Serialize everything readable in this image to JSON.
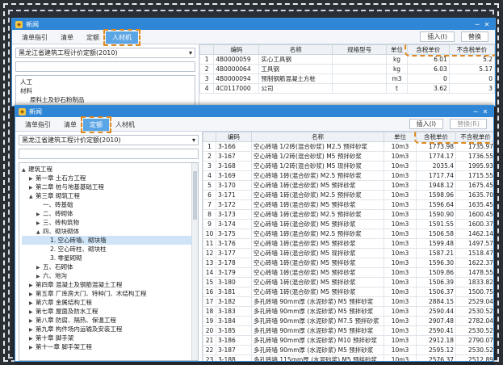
{
  "app_title": "新闻",
  "back": {
    "tabs": [
      "清单指引",
      "清单",
      "定额",
      "人材机"
    ],
    "active_tab": 3,
    "insert_button": "插入(I)",
    "replace_button": "替换",
    "standard": "黑龙江省建筑工程计价定额(2010)",
    "tree": [
      "人工",
      "材料",
      "原料土及砂石粉制品"
    ],
    "columns": [
      "编码",
      "名称",
      "规格型号",
      "单位",
      "含税单价",
      "不含税单价"
    ],
    "rows": [
      [
        "1",
        "4B0000059",
        "实心工具钢",
        "",
        "kg",
        "6.01",
        "5.2"
      ],
      [
        "2",
        "4B0000064",
        "工具钢",
        "",
        "kg",
        "6.03",
        "5.17"
      ],
      [
        "3",
        "4B0000094",
        "预制钢筋混凝土方桩",
        "",
        "m3",
        "0",
        "0"
      ],
      [
        "4",
        "4C0117000",
        "公司",
        "",
        "t",
        "3.62",
        "3"
      ]
    ]
  },
  "front": {
    "tabs": [
      "清单指引",
      "清单",
      "定额",
      "人材机"
    ],
    "active_tab": 2,
    "insert_button": "插入(I)",
    "replace_button": "替换(R)",
    "standard": "黑龙江省建筑工程计价定额(2010)",
    "tree": [
      {
        "label": "建筑工程",
        "indent": 0,
        "icon": "▲"
      },
      {
        "label": "第一章 土石方工程",
        "indent": 1,
        "icon": "▶"
      },
      {
        "label": "第二章 桩与地基基础工程",
        "indent": 1,
        "icon": "▶"
      },
      {
        "label": "第三章 砌筑工程",
        "indent": 1,
        "icon": "▲"
      },
      {
        "label": "一、砖基础",
        "indent": 2,
        "icon": ""
      },
      {
        "label": "二、砖砌体",
        "indent": 2,
        "icon": "▶"
      },
      {
        "label": "三、砖构筑物",
        "indent": 2,
        "icon": "▶"
      },
      {
        "label": "四、砌块砌体",
        "indent": 2,
        "icon": "▲"
      },
      {
        "label": "1. 空心砖墙、砌块墙",
        "indent": 3,
        "icon": "",
        "selected": true
      },
      {
        "label": "2. 空心砖柱、砌块柱",
        "indent": 3,
        "icon": ""
      },
      {
        "label": "3. 零星砌砌",
        "indent": 3,
        "icon": ""
      },
      {
        "label": "五、石砌体",
        "indent": 2,
        "icon": "▶"
      },
      {
        "label": "六、地沟",
        "indent": 2,
        "icon": "▶"
      },
      {
        "label": "第四章 混凝土及钢筋混凝土工程",
        "indent": 1,
        "icon": "▶"
      },
      {
        "label": "第五章 厂库房大门、特种门、木结构工程",
        "indent": 1,
        "icon": "▶"
      },
      {
        "label": "第六章 金属结构工程",
        "indent": 1,
        "icon": "▶"
      },
      {
        "label": "第七章 屋面及防水工程",
        "indent": 1,
        "icon": "▶"
      },
      {
        "label": "第八章 防腐、隔热、保温工程",
        "indent": 1,
        "icon": "▶"
      },
      {
        "label": "第九章 构件场内运输及安装工程",
        "indent": 1,
        "icon": "▶"
      },
      {
        "label": "第十章 脚手架",
        "indent": 1,
        "icon": "▶"
      },
      {
        "label": "第十一章 脚手架工程",
        "indent": 1,
        "icon": "▶"
      }
    ],
    "columns": [
      "编码",
      "名称",
      "单位",
      "含税单价",
      "不含税单价"
    ],
    "rows": [
      [
        "1",
        "3-166",
        "空心砖墙 1/2砖(混合砂浆) M2.5 预拌砂浆",
        "10m3",
        "1773.98",
        "1735.97"
      ],
      [
        "2",
        "3-167",
        "空心砖墙 1/2砖(混合砂浆) M5 预拌砂浆",
        "10m3",
        "1774.17",
        "1736.55"
      ],
      [
        "3",
        "3-168",
        "空心砖墙 1/2砖(混合砂浆) M5 现拌砂浆",
        "10m3",
        "2035.4",
        "1995.93"
      ],
      [
        "4",
        "3-169",
        "空心砖墙 1砖(混合砂浆) M2.5 预拌砂浆",
        "10m3",
        "1717.74",
        "1715.55"
      ],
      [
        "5",
        "3-170",
        "空心砖墙 1砖(混合砂浆) M5 预拌砂浆",
        "10m3",
        "1948.12",
        "1675.45"
      ],
      [
        "6",
        "3-171",
        "空心砖墙 1砖(混合砂浆) M2.5 预拌砂浆",
        "10m3",
        "1598.96",
        "1635.70"
      ],
      [
        "7",
        "3-172",
        "空心砖墙 1砖(混合砂浆) M5 预拌砂浆",
        "10m3",
        "1596.64",
        "1635.45"
      ],
      [
        "8",
        "3-173",
        "空心砖墙 1砖(混合砂浆) M2.5 预拌砂浆",
        "10m3",
        "1590.90",
        "1600.45"
      ],
      [
        "9",
        "3-174",
        "空心砖墙 1砖(混合砂浆) M5 预拌砂浆",
        "10m3",
        "1591.55",
        "1600.37"
      ],
      [
        "10",
        "3-175",
        "空心砖墙 1砖(混合砂浆) M2.5 预拌砂浆",
        "10m3",
        "1506.58",
        "1462.14"
      ],
      [
        "11",
        "3-176",
        "空心砖墙 1砖(混合砂浆) M5 预拌砂浆",
        "10m3",
        "1599.48",
        "1497.57"
      ],
      [
        "12",
        "3-177",
        "空心砖墙 1砖(混合砂浆) M5 现拌砂浆",
        "10m3",
        "1587.21",
        "1518.47"
      ],
      [
        "13",
        "3-178",
        "空心砖墙 1砖(混合砂浆) M5 预拌砂浆",
        "10m3",
        "1596.30",
        "1622.37"
      ],
      [
        "14",
        "3-179",
        "空心砖墙 1砖(混合砂浆) M5 预拌砂浆",
        "10m3",
        "1509.86",
        "1478.55"
      ],
      [
        "15",
        "3-180",
        "空心砖墙 1砖(混合砂浆) M5 预拌砂浆",
        "10m3",
        "1506.39",
        "1833.82"
      ],
      [
        "16",
        "3-181",
        "空心砖墙 1砖(混合砂浆) M5 预拌砂浆",
        "10m3",
        "1506.37",
        "1500.75"
      ],
      [
        "17",
        "3-182",
        "多孔砖墙 90mm厚 (水泥砂浆) M5 预拌砂浆",
        "10m3",
        "2884.15",
        "2529.04"
      ],
      [
        "18",
        "3-183",
        "多孔砖墙 90mm厚 (水泥砂浆) M5 预拌砂浆",
        "10m3",
        "2590.44",
        "2530.52"
      ],
      [
        "19",
        "3-184",
        "多孔砖墙 90mm厚 (水泥砂浆) M7.5 预拌砂浆",
        "10m3",
        "2907.48",
        "2782.04"
      ],
      [
        "20",
        "3-185",
        "多孔砖墙 90mm厚 (水泥砂浆) M5 预拌砂浆",
        "10m3",
        "2590.41",
        "2530.52"
      ],
      [
        "21",
        "3-186",
        "多孔砖墙 90mm厚 (水泥砂浆) M10 预拌砂浆",
        "10m3",
        "2912.18",
        "2790.07"
      ],
      [
        "22",
        "3-187",
        "多孔砖墙 90mm厚 (水泥砂浆) M5 预拌砂浆",
        "10m3",
        "2595.12",
        "2530.52"
      ],
      [
        "23",
        "3-188",
        "多孔砖墙 115mm厚 (水泥砂浆) M5 预拌砂浆",
        "10m3",
        "2576.37",
        "2512.89"
      ],
      [
        "24",
        "3-189",
        "多孔砖墙 115mm厚 (水泥砂浆) M5 预拌砂浆",
        "10m3",
        "2540.70",
        "2530.24"
      ]
    ]
  },
  "colors": {
    "accent": "#2f86d6",
    "highlight": "#e08a1e",
    "active_tab": "#5aa5e6"
  }
}
